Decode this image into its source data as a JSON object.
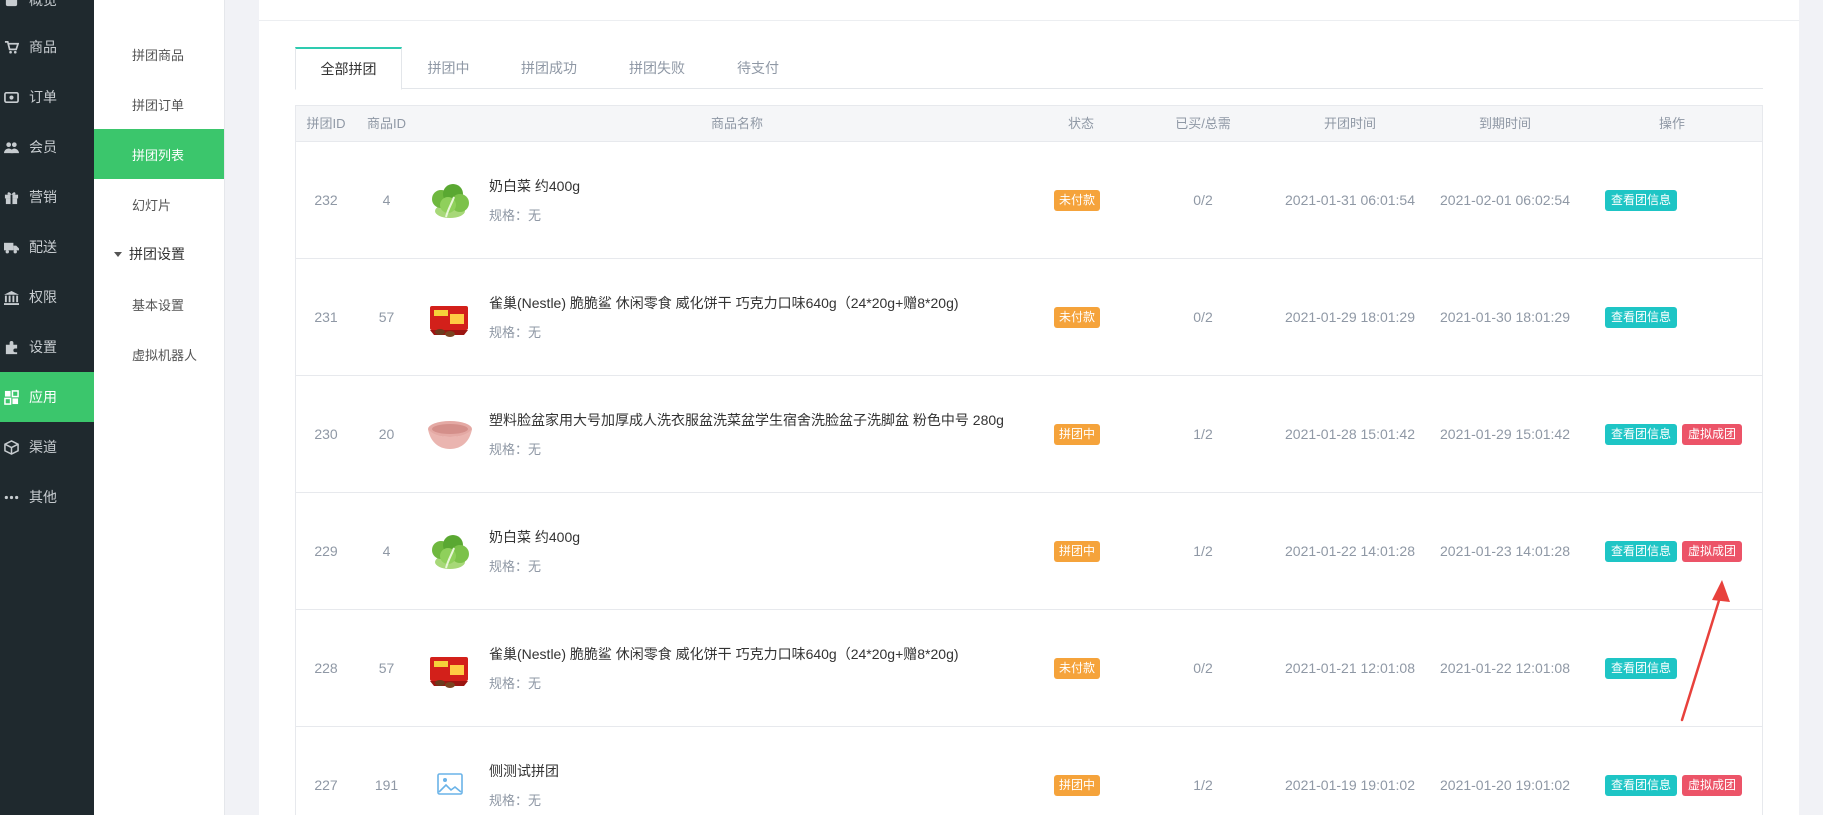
{
  "colors": {
    "sidebar_bg": "#1f292e",
    "accent_green": "#3bc66c",
    "tab_accent": "#2ecbb0",
    "unpaid_badge": "#f5a33b",
    "view_button": "#1ec5c5",
    "virtual_button": "#ec5468",
    "annotation_arrow": "#e8413c"
  },
  "sidebar": {
    "partial_top_label": "概览",
    "items": [
      {
        "label": "商品",
        "icon": "cart-icon"
      },
      {
        "label": "订单",
        "icon": "money-icon"
      },
      {
        "label": "会员",
        "icon": "users-icon"
      },
      {
        "label": "营销",
        "icon": "gift-icon"
      },
      {
        "label": "配送",
        "icon": "truck-icon"
      },
      {
        "label": "权限",
        "icon": "bank-icon"
      },
      {
        "label": "设置",
        "icon": "puzzle-icon"
      },
      {
        "label": "应用",
        "icon": "apps-icon",
        "active": true
      },
      {
        "label": "渠道",
        "icon": "cube-icon"
      },
      {
        "label": "其他",
        "icon": "more-icon"
      }
    ]
  },
  "subnav": {
    "items": [
      {
        "label": "拼团商品"
      },
      {
        "label": "拼团订单"
      },
      {
        "label": "拼团列表",
        "active": true
      },
      {
        "label": "幻灯片"
      }
    ],
    "group": {
      "label": "拼团设置",
      "children": [
        {
          "label": "基本设置"
        },
        {
          "label": "虚拟机器人"
        }
      ]
    }
  },
  "tabs": [
    {
      "label": "全部拼团",
      "active": true
    },
    {
      "label": "拼团中"
    },
    {
      "label": "拼团成功"
    },
    {
      "label": "拼团失败"
    },
    {
      "label": "待支付"
    }
  ],
  "table": {
    "headers": [
      "拼团ID",
      "商品ID",
      "商品名称",
      "状态",
      "已买/总需",
      "开团时间",
      "到期时间",
      "操作"
    ],
    "spec_prefix": "规格：",
    "view_label": "查看团信息",
    "virtual_label": "虚拟成团",
    "rows": [
      {
        "id": "232",
        "goods_id": "4",
        "name": "奶白菜 约400g",
        "spec": "无",
        "thumb": "cabbage-image",
        "status": "未付款",
        "status_color": "#f5a33b",
        "progress": "0/2",
        "start": "2021-01-31 06:01:54",
        "end": "2021-02-01 06:02:54",
        "virtual": false
      },
      {
        "id": "231",
        "goods_id": "57",
        "name": "雀巢(Nestle) 脆脆鲨 休闲零食 威化饼干 巧克力口味640g（24*20g+赠8*20g)",
        "spec": "无",
        "thumb": "snack-box-image",
        "status": "未付款",
        "status_color": "#f5a33b",
        "progress": "0/2",
        "start": "2021-01-29 18:01:29",
        "end": "2021-01-30 18:01:29",
        "virtual": false
      },
      {
        "id": "230",
        "goods_id": "20",
        "name": "塑料脸盆家用大号加厚成人洗衣服盆洗菜盆学生宿舍洗脸盆子洗脚盆 粉色中号 280g",
        "spec": "无",
        "thumb": "basin-image",
        "status": "拼团中",
        "status_color": "#f5a33b",
        "progress": "1/2",
        "start": "2021-01-28 15:01:42",
        "end": "2021-01-29 15:01:42",
        "virtual": true
      },
      {
        "id": "229",
        "goods_id": "4",
        "name": "奶白菜 约400g",
        "spec": "无",
        "thumb": "cabbage-image",
        "status": "拼团中",
        "status_color": "#f5a33b",
        "progress": "1/2",
        "start": "2021-01-22 14:01:28",
        "end": "2021-01-23 14:01:28",
        "virtual": true
      },
      {
        "id": "228",
        "goods_id": "57",
        "name": "雀巢(Nestle) 脆脆鲨 休闲零食 威化饼干 巧克力口味640g（24*20g+赠8*20g)",
        "spec": "无",
        "thumb": "snack-box-image",
        "status": "未付款",
        "status_color": "#f5a33b",
        "progress": "0/2",
        "start": "2021-01-21 12:01:08",
        "end": "2021-01-22 12:01:08",
        "virtual": false
      },
      {
        "id": "227",
        "goods_id": "191",
        "name": "侧测试拼团",
        "spec": "无",
        "thumb": "placeholder-image",
        "status": "拼团中",
        "status_color": "#f5a33b",
        "progress": "1/2",
        "start": "2021-01-19 19:01:02",
        "end": "2021-01-20 19:01:02",
        "virtual": true
      }
    ]
  }
}
